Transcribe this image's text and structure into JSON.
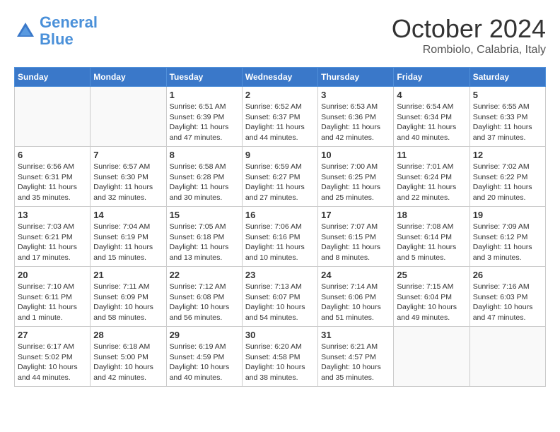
{
  "header": {
    "logo_line1": "General",
    "logo_line2": "Blue",
    "month": "October 2024",
    "location": "Rombiolo, Calabria, Italy"
  },
  "weekdays": [
    "Sunday",
    "Monday",
    "Tuesday",
    "Wednesday",
    "Thursday",
    "Friday",
    "Saturday"
  ],
  "weeks": [
    [
      {
        "day": "",
        "info": ""
      },
      {
        "day": "",
        "info": ""
      },
      {
        "day": "1",
        "info": "Sunrise: 6:51 AM\nSunset: 6:39 PM\nDaylight: 11 hours and 47 minutes."
      },
      {
        "day": "2",
        "info": "Sunrise: 6:52 AM\nSunset: 6:37 PM\nDaylight: 11 hours and 44 minutes."
      },
      {
        "day": "3",
        "info": "Sunrise: 6:53 AM\nSunset: 6:36 PM\nDaylight: 11 hours and 42 minutes."
      },
      {
        "day": "4",
        "info": "Sunrise: 6:54 AM\nSunset: 6:34 PM\nDaylight: 11 hours and 40 minutes."
      },
      {
        "day": "5",
        "info": "Sunrise: 6:55 AM\nSunset: 6:33 PM\nDaylight: 11 hours and 37 minutes."
      }
    ],
    [
      {
        "day": "6",
        "info": "Sunrise: 6:56 AM\nSunset: 6:31 PM\nDaylight: 11 hours and 35 minutes."
      },
      {
        "day": "7",
        "info": "Sunrise: 6:57 AM\nSunset: 6:30 PM\nDaylight: 11 hours and 32 minutes."
      },
      {
        "day": "8",
        "info": "Sunrise: 6:58 AM\nSunset: 6:28 PM\nDaylight: 11 hours and 30 minutes."
      },
      {
        "day": "9",
        "info": "Sunrise: 6:59 AM\nSunset: 6:27 PM\nDaylight: 11 hours and 27 minutes."
      },
      {
        "day": "10",
        "info": "Sunrise: 7:00 AM\nSunset: 6:25 PM\nDaylight: 11 hours and 25 minutes."
      },
      {
        "day": "11",
        "info": "Sunrise: 7:01 AM\nSunset: 6:24 PM\nDaylight: 11 hours and 22 minutes."
      },
      {
        "day": "12",
        "info": "Sunrise: 7:02 AM\nSunset: 6:22 PM\nDaylight: 11 hours and 20 minutes."
      }
    ],
    [
      {
        "day": "13",
        "info": "Sunrise: 7:03 AM\nSunset: 6:21 PM\nDaylight: 11 hours and 17 minutes."
      },
      {
        "day": "14",
        "info": "Sunrise: 7:04 AM\nSunset: 6:19 PM\nDaylight: 11 hours and 15 minutes."
      },
      {
        "day": "15",
        "info": "Sunrise: 7:05 AM\nSunset: 6:18 PM\nDaylight: 11 hours and 13 minutes."
      },
      {
        "day": "16",
        "info": "Sunrise: 7:06 AM\nSunset: 6:16 PM\nDaylight: 11 hours and 10 minutes."
      },
      {
        "day": "17",
        "info": "Sunrise: 7:07 AM\nSunset: 6:15 PM\nDaylight: 11 hours and 8 minutes."
      },
      {
        "day": "18",
        "info": "Sunrise: 7:08 AM\nSunset: 6:14 PM\nDaylight: 11 hours and 5 minutes."
      },
      {
        "day": "19",
        "info": "Sunrise: 7:09 AM\nSunset: 6:12 PM\nDaylight: 11 hours and 3 minutes."
      }
    ],
    [
      {
        "day": "20",
        "info": "Sunrise: 7:10 AM\nSunset: 6:11 PM\nDaylight: 11 hours and 1 minute."
      },
      {
        "day": "21",
        "info": "Sunrise: 7:11 AM\nSunset: 6:09 PM\nDaylight: 10 hours and 58 minutes."
      },
      {
        "day": "22",
        "info": "Sunrise: 7:12 AM\nSunset: 6:08 PM\nDaylight: 10 hours and 56 minutes."
      },
      {
        "day": "23",
        "info": "Sunrise: 7:13 AM\nSunset: 6:07 PM\nDaylight: 10 hours and 54 minutes."
      },
      {
        "day": "24",
        "info": "Sunrise: 7:14 AM\nSunset: 6:06 PM\nDaylight: 10 hours and 51 minutes."
      },
      {
        "day": "25",
        "info": "Sunrise: 7:15 AM\nSunset: 6:04 PM\nDaylight: 10 hours and 49 minutes."
      },
      {
        "day": "26",
        "info": "Sunrise: 7:16 AM\nSunset: 6:03 PM\nDaylight: 10 hours and 47 minutes."
      }
    ],
    [
      {
        "day": "27",
        "info": "Sunrise: 6:17 AM\nSunset: 5:02 PM\nDaylight: 10 hours and 44 minutes."
      },
      {
        "day": "28",
        "info": "Sunrise: 6:18 AM\nSunset: 5:00 PM\nDaylight: 10 hours and 42 minutes."
      },
      {
        "day": "29",
        "info": "Sunrise: 6:19 AM\nSunset: 4:59 PM\nDaylight: 10 hours and 40 minutes."
      },
      {
        "day": "30",
        "info": "Sunrise: 6:20 AM\nSunset: 4:58 PM\nDaylight: 10 hours and 38 minutes."
      },
      {
        "day": "31",
        "info": "Sunrise: 6:21 AM\nSunset: 4:57 PM\nDaylight: 10 hours and 35 minutes."
      },
      {
        "day": "",
        "info": ""
      },
      {
        "day": "",
        "info": ""
      }
    ]
  ]
}
